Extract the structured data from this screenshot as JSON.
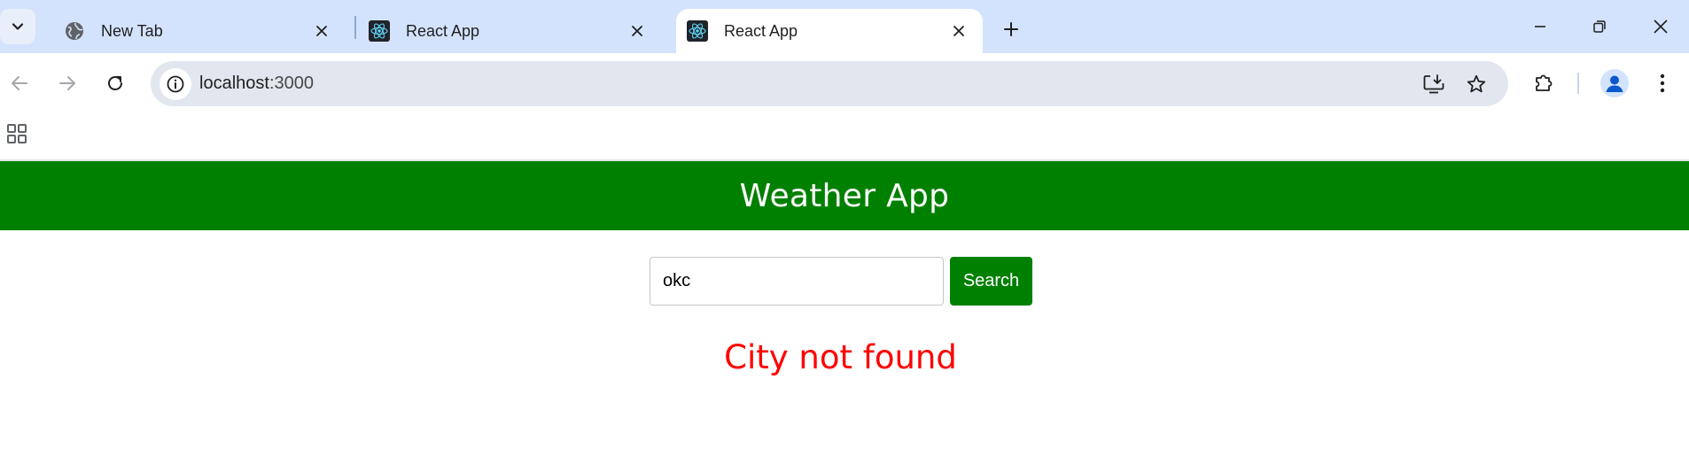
{
  "browser": {
    "tabs": [
      {
        "title": "New Tab",
        "favicon": "globe-icon",
        "active": false
      },
      {
        "title": "React App",
        "favicon": "react-icon",
        "active": false
      },
      {
        "title": "React App",
        "favicon": "react-icon",
        "active": true
      }
    ],
    "address_bar": {
      "host": "localhost",
      "port": ":3000"
    },
    "colors": {
      "tabstrip": "#d3e3fd",
      "omnibox": "#e2e7ef"
    }
  },
  "app": {
    "title": "Weather App",
    "search": {
      "value": "okc",
      "button_label": "Search"
    },
    "error": "City not found",
    "colors": {
      "header": "#008000",
      "button": "#008000",
      "error": "#ff0000"
    }
  }
}
